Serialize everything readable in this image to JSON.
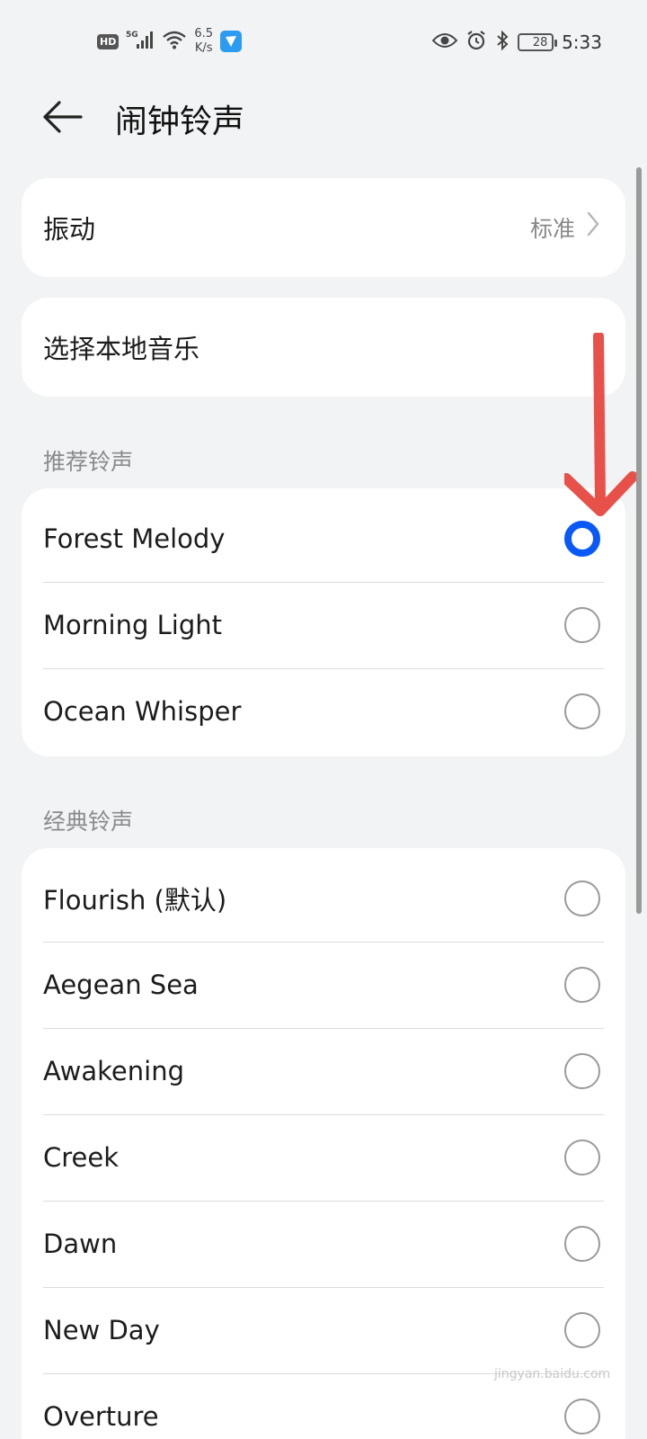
{
  "status_bar": {
    "hd": "HD",
    "net_type": "5G",
    "speed_value": "6.5",
    "speed_unit": "K/s",
    "battery": "28",
    "time": "5:33",
    "icons": [
      "signal-icon",
      "wifi-icon",
      "app-icon",
      "eye-icon",
      "alarm-icon",
      "bluetooth-icon",
      "battery-icon"
    ]
  },
  "header": {
    "title": "闹钟铃声",
    "back_icon": "arrow-left-icon"
  },
  "vibration": {
    "label": "振动",
    "value": "标准"
  },
  "local_music": {
    "label": "选择本地音乐"
  },
  "recommended": {
    "title": "推荐铃声",
    "items": [
      {
        "label": "Forest Melody",
        "selected": true
      },
      {
        "label": "Morning Light",
        "selected": false
      },
      {
        "label": "Ocean Whisper",
        "selected": false
      }
    ]
  },
  "classic": {
    "title": "经典铃声",
    "items": [
      {
        "label": "Flourish (默认)",
        "selected": false
      },
      {
        "label": "Aegean Sea",
        "selected": false
      },
      {
        "label": "Awakening",
        "selected": false
      },
      {
        "label": "Creek",
        "selected": false
      },
      {
        "label": "Dawn",
        "selected": false
      },
      {
        "label": "New Day",
        "selected": false
      },
      {
        "label": "Overture",
        "selected": false
      }
    ]
  },
  "colors": {
    "accent": "#0a59f7",
    "annotation_arrow": "#e8504a",
    "background": "#f1f3f5"
  },
  "watermark": "jingyan.baidu.com"
}
